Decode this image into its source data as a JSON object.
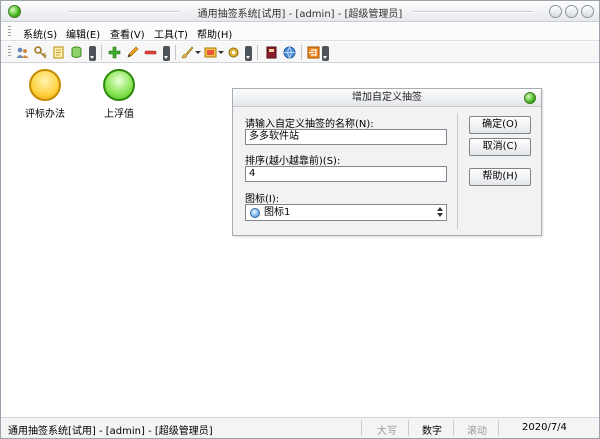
{
  "window": {
    "title": "通用抽签系统[试用] - [admin] - [超级管理员]"
  },
  "menu": {
    "items": [
      {
        "label": "系统(S)"
      },
      {
        "label": "编辑(E)"
      },
      {
        "label": "查看(V)"
      },
      {
        "label": "工具(T)"
      },
      {
        "label": "帮助(H)"
      }
    ]
  },
  "toolbar": {
    "icons": [
      "users-icon",
      "key-icon",
      "notepad-icon",
      "database-icon",
      "add-icon",
      "edit-pencil-icon",
      "remove-icon",
      "brush-icon",
      "frame-icon",
      "gear-icon",
      "book-icon",
      "globe-icon",
      "exit-icon"
    ]
  },
  "tags": [
    {
      "label": "评标办法",
      "color": "#ffd54a"
    },
    {
      "label": "上浮值",
      "color": "#8ee65a"
    }
  ],
  "dialog": {
    "title": "增加自定义抽签",
    "name_label": "请输入自定义抽签的名称(N):",
    "name_value": "多多软件站",
    "order_label": "排序(越小越靠前)(S):",
    "order_value": "4",
    "icon_label": "图标(I):",
    "icon_value": "图标1",
    "ok_label": "确定(O)",
    "cancel_label": "取消(C)",
    "help_label": "帮助(H)"
  },
  "status": {
    "app_text": "通用抽签系统[试用] - [admin] - [超级管理员]",
    "caps": "大写",
    "num": "数字",
    "scroll": "滚动",
    "date": "2020/7/4"
  },
  "colors": {
    "accent_green": "#46b51b",
    "accent_yellow": "#ffd54a"
  }
}
